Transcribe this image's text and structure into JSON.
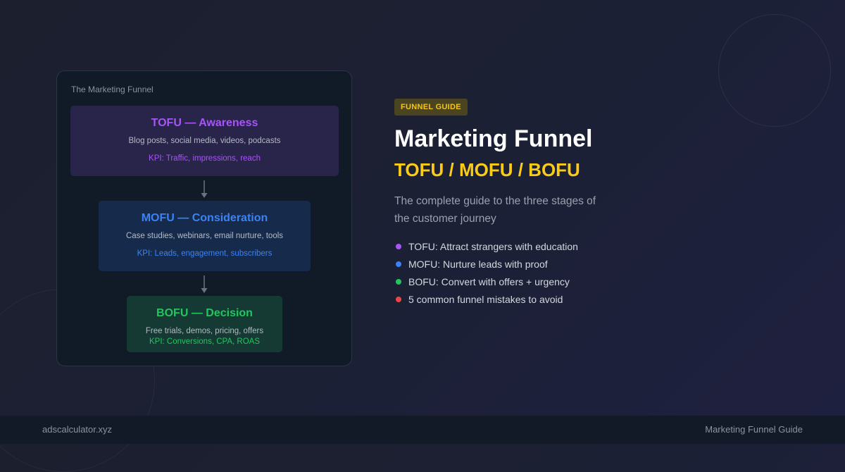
{
  "funnel": {
    "title": "The Marketing Funnel",
    "stages": [
      {
        "name": "TOFU — Awareness",
        "description": "Blog posts, social media, videos, podcasts",
        "kpi": "KPI: Traffic, impressions, reach",
        "color": "#a855f7"
      },
      {
        "name": "MOFU — Consideration",
        "description": "Case studies, webinars, email nurture, tools",
        "kpi": "KPI: Leads, engagement, subscribers",
        "color": "#3b82f6"
      },
      {
        "name": "BOFU — Decision",
        "description": "Free trials, demos, pricing, offers",
        "kpi": "KPI: Conversions, CPA, ROAS",
        "color": "#22c55e"
      }
    ]
  },
  "hero": {
    "badge": "FUNNEL GUIDE",
    "title": "Marketing Funnel",
    "subtitle": "TOFU / MOFU / BOFU",
    "description": "The complete guide to the three stages of the customer journey",
    "bullets": [
      {
        "text": "TOFU: Attract strangers with education",
        "color": "#a855f7"
      },
      {
        "text": "MOFU: Nurture leads with proof",
        "color": "#3b82f6"
      },
      {
        "text": "BOFU: Convert with offers + urgency",
        "color": "#22c55e"
      },
      {
        "text": "5 common funnel mistakes to avoid",
        "color": "#ef4444"
      }
    ]
  },
  "footer": {
    "site": "adscalculator.xyz",
    "label": "Marketing Funnel Guide"
  },
  "colors": {
    "accent_yellow": "#facc15",
    "background": "#1c1f2e"
  }
}
